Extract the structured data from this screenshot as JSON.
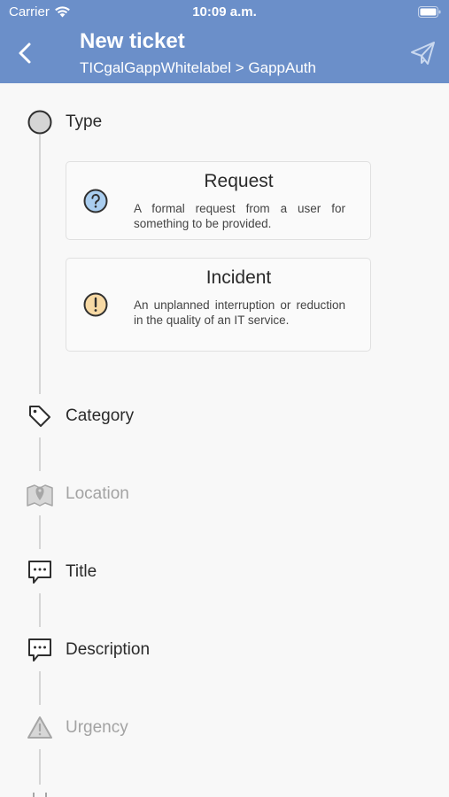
{
  "status_bar": {
    "carrier": "Carrier",
    "time": "10:09 a.m.",
    "icons": [
      "wifi-icon",
      "battery-icon"
    ]
  },
  "header": {
    "title": "New ticket",
    "breadcrumb": "TICgalGappWhitelabel > GappAuth",
    "back_icon": "chevron-left-icon",
    "send_icon": "paper-plane-icon",
    "background": "#6b8fc9"
  },
  "steps": [
    {
      "label": "Type",
      "icon": "circle-icon",
      "enabled": true
    },
    {
      "label": "Category",
      "icon": "tag-icon",
      "enabled": true
    },
    {
      "label": "Location",
      "icon": "map-pin-icon",
      "enabled": false
    },
    {
      "label": "Title",
      "icon": "speech-bubble-icon",
      "enabled": true
    },
    {
      "label": "Description",
      "icon": "speech-bubble-icon",
      "enabled": true
    },
    {
      "label": "Urgency",
      "icon": "warning-icon",
      "enabled": false
    }
  ],
  "type_options": [
    {
      "title": "Request",
      "description": "A formal request from a user for something to be provided.",
      "icon": "question-icon",
      "icon_color": "#a9cdef"
    },
    {
      "title": "Incident",
      "description": "An unplanned interruption or reduction in the quality of an IT service.",
      "icon": "exclamation-icon",
      "icon_color": "#f7d9a4"
    }
  ]
}
